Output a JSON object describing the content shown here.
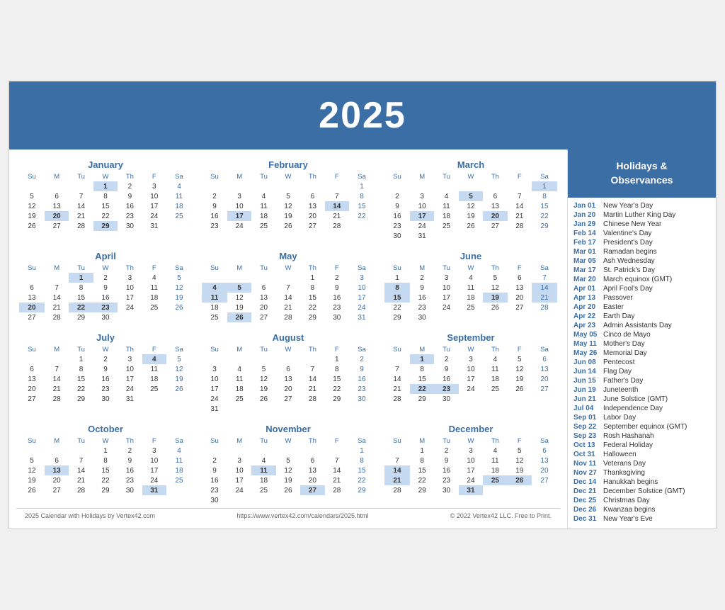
{
  "header": {
    "year": "2025"
  },
  "sidebar": {
    "title": "Holidays &\nObservances",
    "holidays": [
      {
        "date": "Jan 01",
        "name": "New Year's Day"
      },
      {
        "date": "Jan 20",
        "name": "Martin Luther King Day"
      },
      {
        "date": "Jan 29",
        "name": "Chinese New Year"
      },
      {
        "date": "Feb 14",
        "name": "Valentine's Day"
      },
      {
        "date": "Feb 17",
        "name": "President's Day"
      },
      {
        "date": "Mar 01",
        "name": "Ramadan begins"
      },
      {
        "date": "Mar 05",
        "name": "Ash Wednesday"
      },
      {
        "date": "Mar 17",
        "name": "St. Patrick's Day"
      },
      {
        "date": "Mar 20",
        "name": "March equinox (GMT)"
      },
      {
        "date": "Apr 01",
        "name": "April Fool's Day"
      },
      {
        "date": "Apr 13",
        "name": "Passover"
      },
      {
        "date": "Apr 20",
        "name": "Easter"
      },
      {
        "date": "Apr 22",
        "name": "Earth Day"
      },
      {
        "date": "Apr 23",
        "name": "Admin Assistants Day"
      },
      {
        "date": "May 05",
        "name": "Cinco de Mayo"
      },
      {
        "date": "May 11",
        "name": "Mother's Day"
      },
      {
        "date": "May 26",
        "name": "Memorial Day"
      },
      {
        "date": "Jun 08",
        "name": "Pentecost"
      },
      {
        "date": "Jun 14",
        "name": "Flag Day"
      },
      {
        "date": "Jun 15",
        "name": "Father's Day"
      },
      {
        "date": "Jun 19",
        "name": "Juneteenth"
      },
      {
        "date": "Jun 21",
        "name": "June Solstice (GMT)"
      },
      {
        "date": "Jul 04",
        "name": "Independence Day"
      },
      {
        "date": "Sep 01",
        "name": "Labor Day"
      },
      {
        "date": "Sep 22",
        "name": "September equinox (GMT)"
      },
      {
        "date": "Sep 23",
        "name": "Rosh Hashanah"
      },
      {
        "date": "Oct 13",
        "name": "Federal Holiday"
      },
      {
        "date": "Oct 31",
        "name": "Halloween"
      },
      {
        "date": "Nov 11",
        "name": "Veterans Day"
      },
      {
        "date": "Nov 27",
        "name": "Thanksgiving"
      },
      {
        "date": "Dec 14",
        "name": "Hanukkah begins"
      },
      {
        "date": "Dec 21",
        "name": "December Solstice (GMT)"
      },
      {
        "date": "Dec 25",
        "name": "Christmas Day"
      },
      {
        "date": "Dec 26",
        "name": "Kwanzaa begins"
      },
      {
        "date": "Dec 31",
        "name": "New Year's Eve"
      }
    ]
  },
  "footer": {
    "left": "2025 Calendar with Holidays by Vertex42.com",
    "center": "https://www.vertex42.com/calendars/2025.html",
    "right": "© 2022 Vertex42 LLC. Free to Print."
  }
}
